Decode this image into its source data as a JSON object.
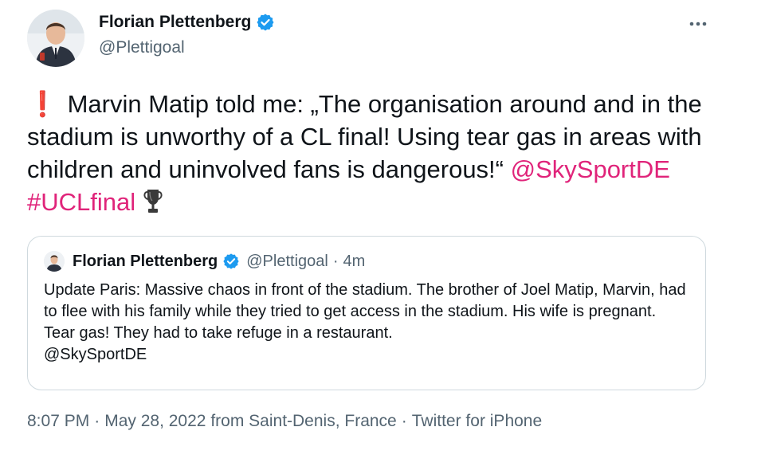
{
  "author": {
    "display_name": "Florian Plettenberg",
    "handle": "@Plettigoal"
  },
  "icons": {
    "verified": "verified-badge-icon",
    "more": "more-options-icon",
    "exclamation": "red-exclamation-emoji",
    "trophy": "trophy-emoji"
  },
  "colors": {
    "link": "#e0247a",
    "verified": "#1d9bf0",
    "secondary_text": "#536471",
    "border": "#cfd9de"
  },
  "tweet": {
    "exclamation": "❗",
    "text": "Marvin Matip told me: „The organisation around and in the stadium is unworthy of a CL final! Using tear gas in areas with children and uninvolved fans is dangerous!“",
    "mention": "@SkySportDE",
    "hashtag": "#UCLfinal"
  },
  "quoted_tweet": {
    "display_name": "Florian Plettenberg",
    "handle": "@Plettigoal",
    "separator": "·",
    "time": "4m",
    "text": "Update Paris: Massive chaos in front of the stadium. The brother of Joel Matip, Marvin, had to flee with his family while they tried to get access in the stadium. His wife is pregnant. Tear gas! They had to take refuge in a restaurant.",
    "mention": "@SkySportDE"
  },
  "meta": {
    "time": "8:07 PM",
    "date": "May 28, 2022",
    "location": "from Saint-Denis, France",
    "source": "Twitter for iPhone",
    "separator": "·"
  }
}
